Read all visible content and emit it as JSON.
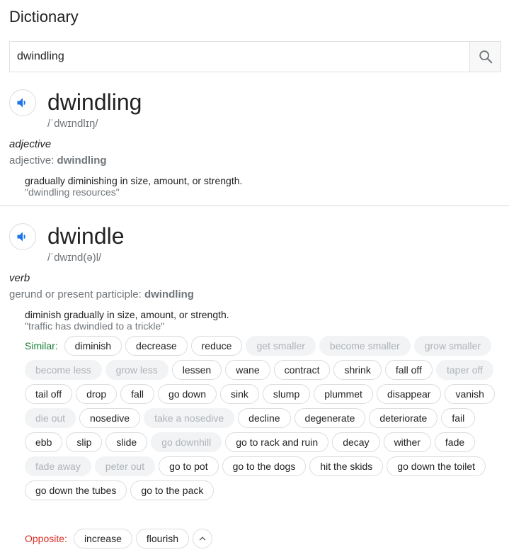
{
  "header": {
    "title": "Dictionary"
  },
  "search": {
    "value": "dwindling"
  },
  "entries": [
    {
      "word": "dwindling",
      "pronunciation": "/ˈdwɪndlɪŋ/",
      "pos": "adjective",
      "inflection_prefix": "adjective: ",
      "inflection_word": "dwindling",
      "definition": "gradually diminishing in size, amount, or strength.",
      "example": "\"dwindling resources\""
    },
    {
      "word": "dwindle",
      "pronunciation": "/ˈdwɪnd(ə)l/",
      "pos": "verb",
      "inflection_prefix": "gerund or present participle: ",
      "inflection_word": "dwindling",
      "definition": "diminish gradually in size, amount, or strength.",
      "example": "\"traffic has dwindled to a trickle\""
    }
  ],
  "similar_label": "Similar:",
  "opposite_label": "Opposite:",
  "similar": [
    {
      "text": "diminish",
      "dim": false
    },
    {
      "text": "decrease",
      "dim": false
    },
    {
      "text": "reduce",
      "dim": false
    },
    {
      "text": "get smaller",
      "dim": true
    },
    {
      "text": "become smaller",
      "dim": true
    },
    {
      "text": "grow smaller",
      "dim": true
    },
    {
      "text": "become less",
      "dim": true
    },
    {
      "text": "grow less",
      "dim": true
    },
    {
      "text": "lessen",
      "dim": false
    },
    {
      "text": "wane",
      "dim": false
    },
    {
      "text": "contract",
      "dim": false
    },
    {
      "text": "shrink",
      "dim": false
    },
    {
      "text": "fall off",
      "dim": false
    },
    {
      "text": "taper off",
      "dim": true
    },
    {
      "text": "tail off",
      "dim": false
    },
    {
      "text": "drop",
      "dim": false
    },
    {
      "text": "fall",
      "dim": false
    },
    {
      "text": "go down",
      "dim": false
    },
    {
      "text": "sink",
      "dim": false
    },
    {
      "text": "slump",
      "dim": false
    },
    {
      "text": "plummet",
      "dim": false
    },
    {
      "text": "disappear",
      "dim": false
    },
    {
      "text": "vanish",
      "dim": false
    },
    {
      "text": "die out",
      "dim": true
    },
    {
      "text": "nosedive",
      "dim": false
    },
    {
      "text": "take a nosedive",
      "dim": true
    },
    {
      "text": "decline",
      "dim": false
    },
    {
      "text": "degenerate",
      "dim": false
    },
    {
      "text": "deteriorate",
      "dim": false
    },
    {
      "text": "fail",
      "dim": false
    },
    {
      "text": "ebb",
      "dim": false
    },
    {
      "text": "slip",
      "dim": false
    },
    {
      "text": "slide",
      "dim": false
    },
    {
      "text": "go downhill",
      "dim": true
    },
    {
      "text": "go to rack and ruin",
      "dim": false
    },
    {
      "text": "decay",
      "dim": false
    },
    {
      "text": "wither",
      "dim": false
    },
    {
      "text": "fade",
      "dim": false
    },
    {
      "text": "fade away",
      "dim": true
    },
    {
      "text": "peter out",
      "dim": true
    },
    {
      "text": "go to pot",
      "dim": false
    },
    {
      "text": "go to the dogs",
      "dim": false
    },
    {
      "text": "hit the skids",
      "dim": false
    },
    {
      "text": "go down the toilet",
      "dim": false
    },
    {
      "text": "go down the tubes",
      "dim": false
    },
    {
      "text": "go to the pack",
      "dim": false
    }
  ],
  "opposite": [
    {
      "text": "increase",
      "dim": false
    },
    {
      "text": "flourish",
      "dim": false
    }
  ],
  "colors": {
    "speaker_icon": "#1a73e8",
    "similar_label": "#188038",
    "opposite_label": "#d93025"
  },
  "icons": {
    "search": "search-icon",
    "speaker": "speaker-icon",
    "collapse": "chevron-up-icon"
  }
}
